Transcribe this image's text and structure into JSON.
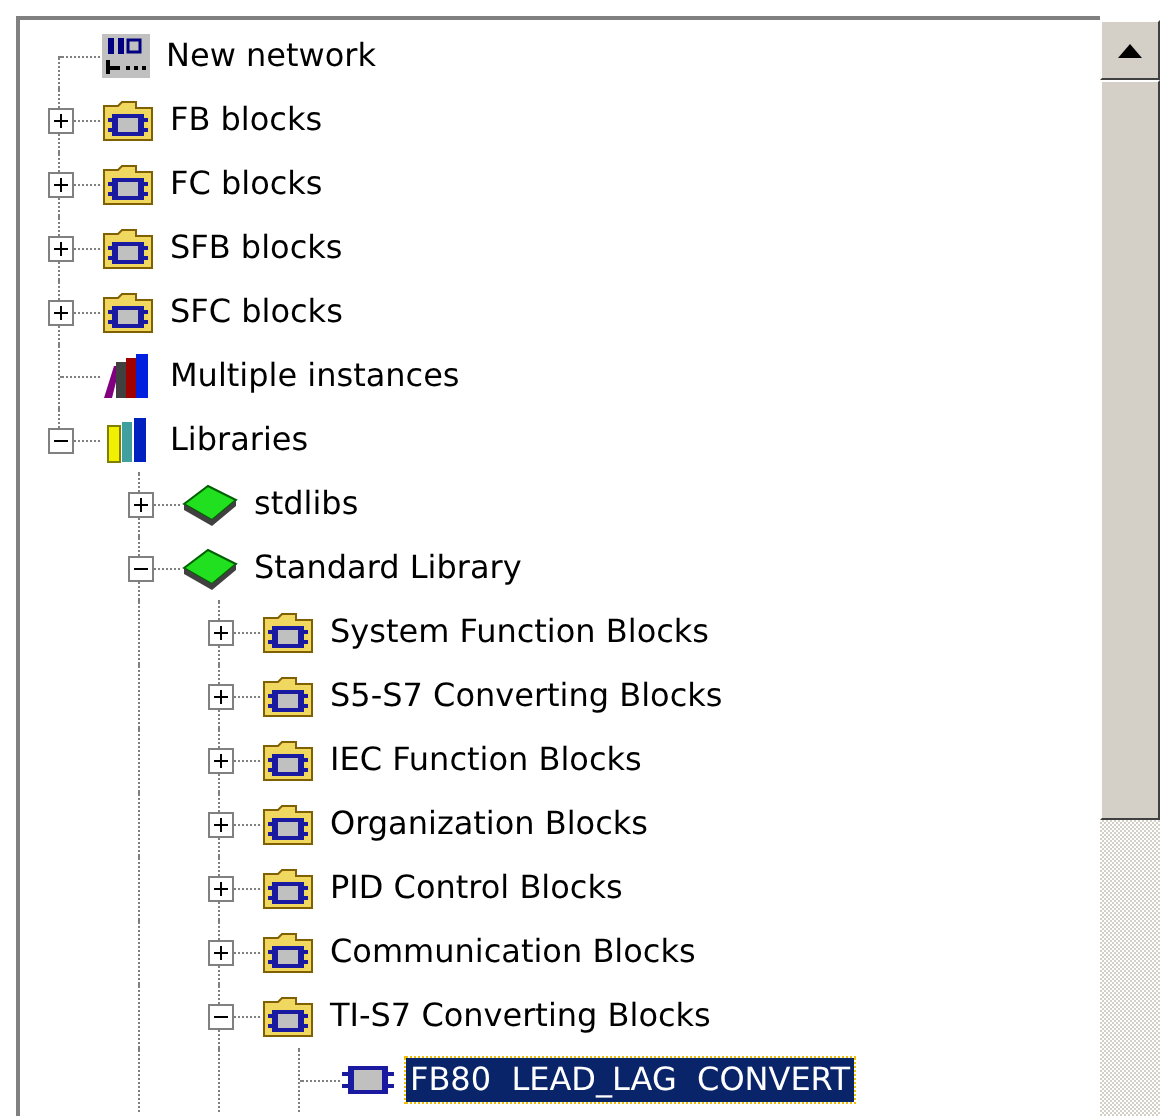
{
  "tree": [
    {
      "label": "New network",
      "kind": "network"
    },
    {
      "label": "FB blocks",
      "kind": "folder",
      "expanded": false
    },
    {
      "label": "FC blocks",
      "kind": "folder",
      "expanded": false
    },
    {
      "label": "SFB blocks",
      "kind": "folder",
      "expanded": false
    },
    {
      "label": "SFC blocks",
      "kind": "folder",
      "expanded": false
    },
    {
      "label": "Multiple instances",
      "kind": "books"
    },
    {
      "label": "Libraries",
      "kind": "library",
      "expanded": true,
      "children": [
        {
          "label": "stdlibs",
          "kind": "book",
          "expanded": false
        },
        {
          "label": "Standard Library",
          "kind": "book",
          "expanded": true,
          "children": [
            {
              "label": "System Function Blocks",
              "kind": "folder",
              "expanded": false
            },
            {
              "label": "S5-S7 Converting Blocks",
              "kind": "folder",
              "expanded": false
            },
            {
              "label": "IEC Function Blocks",
              "kind": "folder",
              "expanded": false
            },
            {
              "label": "Organization Blocks",
              "kind": "folder",
              "expanded": false
            },
            {
              "label": "PID Control Blocks",
              "kind": "folder",
              "expanded": false
            },
            {
              "label": "Communication Blocks",
              "kind": "folder",
              "expanded": false
            },
            {
              "label": "TI-S7 Converting Blocks",
              "kind": "folder",
              "expanded": true,
              "children": [
                {
                  "label": "FB80  LEAD_LAG  CONVERT",
                  "kind": "block",
                  "selected": true
                }
              ]
            }
          ]
        }
      ]
    }
  ]
}
